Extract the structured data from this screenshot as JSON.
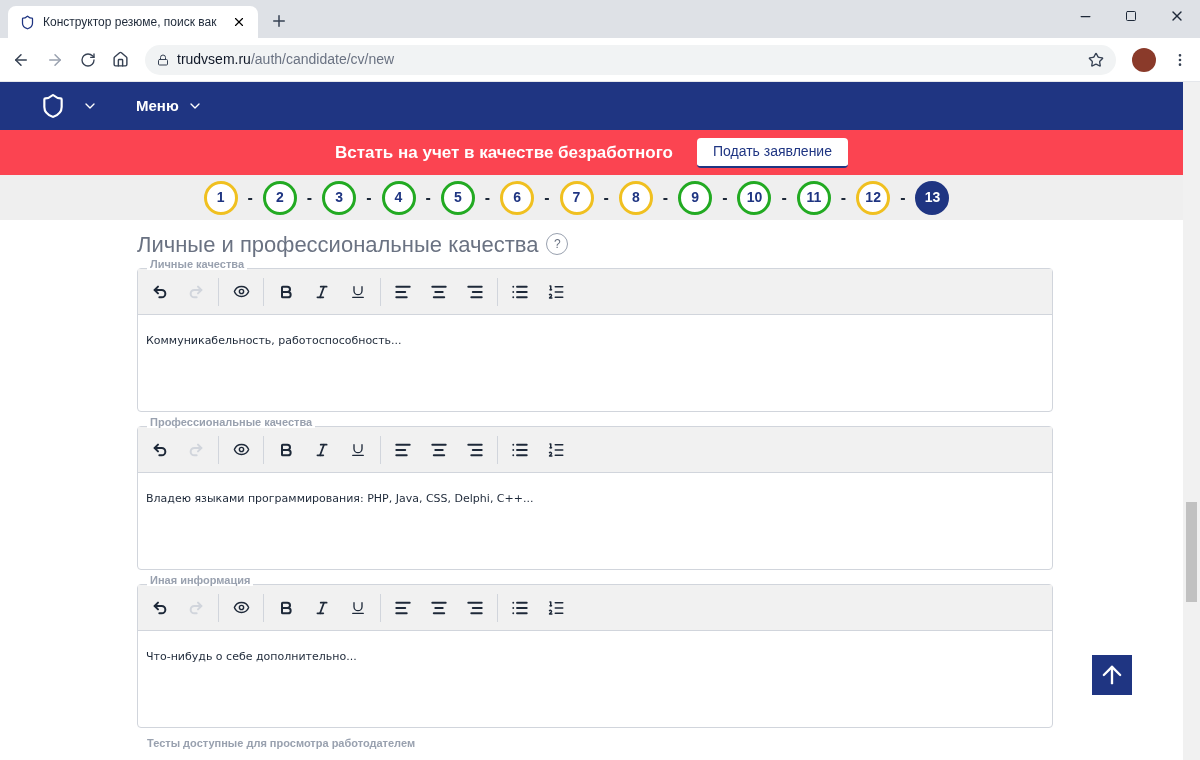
{
  "browser": {
    "tab_title": "Конструктор резюме, поиск вак",
    "url_host": "trudvsem.ru",
    "url_path": "/auth/candidate/cv/new"
  },
  "nav": {
    "menu_label": "Меню"
  },
  "banner": {
    "text": "Встать на учет в качестве безработного",
    "button": "Подать заявление"
  },
  "steps": [
    {
      "label": "1",
      "color": "#f0c020",
      "selected": false
    },
    {
      "label": "2",
      "color": "#22aa22",
      "selected": false
    },
    {
      "label": "3",
      "color": "#22aa22",
      "selected": false
    },
    {
      "label": "4",
      "color": "#22aa22",
      "selected": false
    },
    {
      "label": "5",
      "color": "#22aa22",
      "selected": false
    },
    {
      "label": "6",
      "color": "#f0c020",
      "selected": false
    },
    {
      "label": "7",
      "color": "#f0c020",
      "selected": false
    },
    {
      "label": "8",
      "color": "#f0c020",
      "selected": false
    },
    {
      "label": "9",
      "color": "#22aa22",
      "selected": false
    },
    {
      "label": "10",
      "color": "#22aa22",
      "selected": false
    },
    {
      "label": "11",
      "color": "#22aa22",
      "selected": false
    },
    {
      "label": "12",
      "color": "#f0c020",
      "selected": false
    },
    {
      "label": "13",
      "color": "#1f3582",
      "selected": true
    }
  ],
  "step_separator": "-",
  "section_title": "Личные и профессиональные качества",
  "help_mark": "?",
  "editors": [
    {
      "legend": "Личные качества",
      "placeholder": "Коммуникабельность, работоспособность..."
    },
    {
      "legend": "Профессиональные качества",
      "placeholder": "Владею языками программирования: PHP, Java, CSS, Delphi, C++..."
    },
    {
      "legend": "Иная информация",
      "placeholder": "Что-нибудь о себе дополнительно..."
    }
  ],
  "next_legend": "Тесты доступные для просмотра работодателем"
}
